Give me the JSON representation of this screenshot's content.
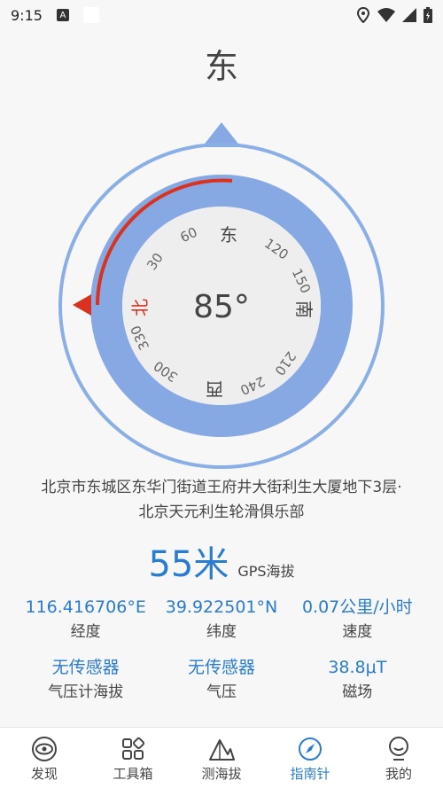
{
  "status_bar": {
    "time": "9:15",
    "app_badge": "A"
  },
  "heading": {
    "direction": "东"
  },
  "compass": {
    "degrees": "85°",
    "heading_value": 85,
    "cardinals": {
      "north": "北",
      "east": "东",
      "south": "南",
      "west": "西"
    },
    "ticks": [
      "30",
      "60",
      "120",
      "150",
      "210",
      "240",
      "300",
      "330"
    ],
    "colors": {
      "ring": "#8aaee6",
      "arc": "#d9331f",
      "pointer": "#86a9e4",
      "face": "#eeeeee"
    }
  },
  "location": {
    "address": "北京市东城区东华门街道王府井大街利生大厦地下3层·北京天元利生轮滑俱乐部"
  },
  "altitude": {
    "value": "55米",
    "label": "GPS海拔"
  },
  "stats": [
    {
      "value": "116.416706°E",
      "label": "经度"
    },
    {
      "value": "39.922501°N",
      "label": "纬度"
    },
    {
      "value": "0.07公里/小时",
      "label": "速度"
    },
    {
      "value": "无传感器",
      "label": "气压计海拔"
    },
    {
      "value": "无传感器",
      "label": "气压"
    },
    {
      "value": "38.8μT",
      "label": "磁场"
    }
  ],
  "nav": [
    {
      "label": "发现",
      "icon": "eye-icon"
    },
    {
      "label": "工具箱",
      "icon": "toolbox-icon"
    },
    {
      "label": "测海拔",
      "icon": "mountain-icon"
    },
    {
      "label": "指南针",
      "icon": "compass-icon"
    },
    {
      "label": "我的",
      "icon": "profile-icon"
    }
  ]
}
